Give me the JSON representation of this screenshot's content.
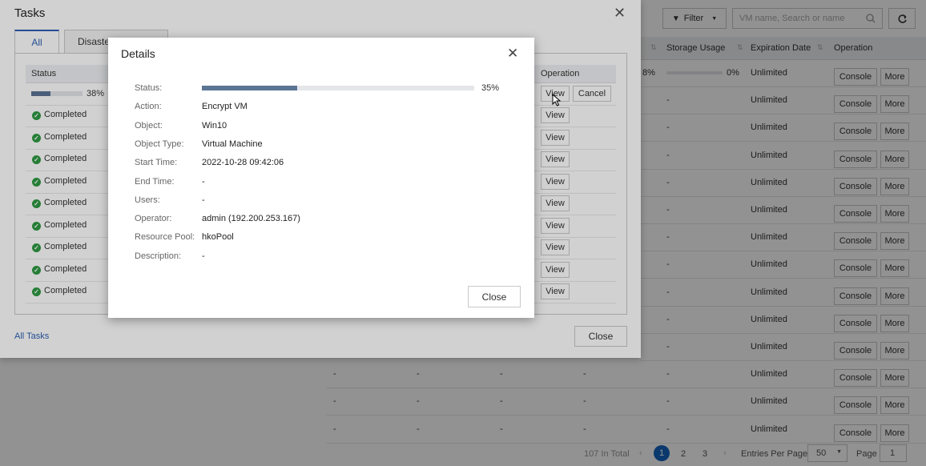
{
  "toolbar": {
    "filter_label": "Filter",
    "search_placeholder": "VM name, Search or name"
  },
  "vm_table": {
    "columns": [
      "Storage Usage",
      "Expiration Date",
      "Operation"
    ],
    "first_row": {
      "left_percent": "8%",
      "storage_percent": "0%",
      "storage_fraction": 0.0
    },
    "dash": "-",
    "expiration": "Unlimited",
    "console_label": "Console",
    "more_label": "More",
    "row_count": 14
  },
  "pagination": {
    "total_text": "107 In Total",
    "pages": [
      "1",
      "2",
      "3"
    ],
    "active_page": "1",
    "entries_label": "Entries Per Page",
    "entries_value": "50",
    "page_label": "Page",
    "page_value": "1"
  },
  "tasks_dialog": {
    "title": "Tasks",
    "tabs": [
      "All",
      "Disaste"
    ],
    "status_header": "Status",
    "operation_header": "Operation",
    "first_task": {
      "percent": "38%",
      "fraction": 0.38
    },
    "completed_label": "Completed",
    "view_label": "View",
    "cancel_label": "Cancel",
    "all_tasks_link": "All Tasks",
    "close_label": "Close"
  },
  "details_dialog": {
    "title": "Details",
    "progress": {
      "fraction": 0.35,
      "text": "35%"
    },
    "fields": [
      {
        "label": "Status:",
        "value": ""
      },
      {
        "label": "Action:",
        "value": "Encrypt VM"
      },
      {
        "label": "Object:",
        "value": "Win10"
      },
      {
        "label": "Object Type:",
        "value": "Virtual Machine"
      },
      {
        "label": "Start Time:",
        "value": "2022-10-28 09:42:06"
      },
      {
        "label": "End Time:",
        "value": "-"
      },
      {
        "label": "Users:",
        "value": "-"
      },
      {
        "label": "Operator:",
        "value": "admin (192.200.253.167)"
      },
      {
        "label": "Resource Pool:",
        "value": "hkoPool"
      },
      {
        "label": "Description:",
        "value": "-"
      }
    ],
    "close_label": "Close"
  },
  "colors": {
    "progress": "#5c7595",
    "link": "#2d5fb5",
    "page_active": "#1565c0",
    "completed": "#2e9a42"
  },
  "icons": [
    "close-icon",
    "filter-icon",
    "search-icon",
    "refresh-icon",
    "sort-icon",
    "check-circle-icon",
    "cursor-icon",
    "chevron-down-icon"
  ]
}
